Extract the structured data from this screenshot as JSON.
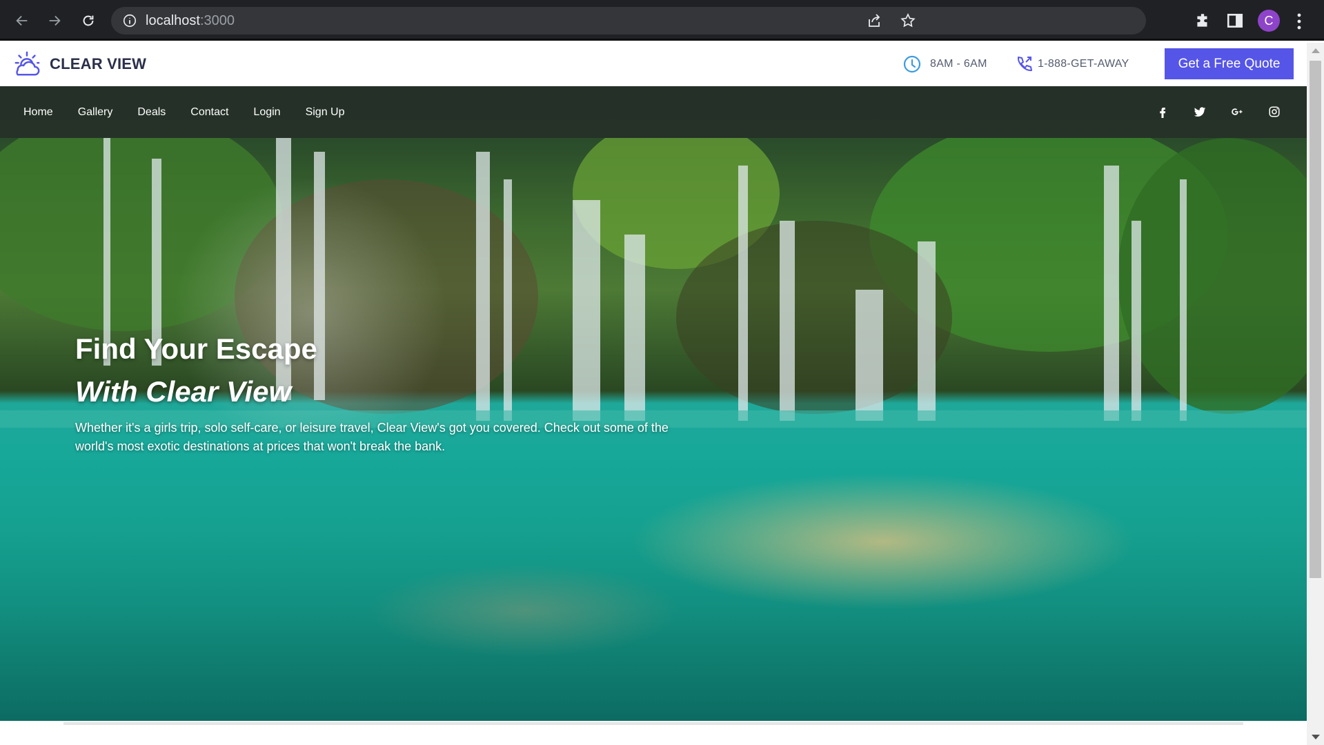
{
  "browser": {
    "url_host": "localhost",
    "url_port": ":3000",
    "profile_initial": "C",
    "profile_color": "#8e44c8"
  },
  "header": {
    "brand": "CLEAR VIEW",
    "hours": "8AM - 6AM",
    "phone": "1-888-GET-AWAY",
    "cta_label": "Get a Free Quote",
    "accent_color": "#5555e8"
  },
  "nav": {
    "links": [
      "Home",
      "Gallery",
      "Deals",
      "Contact",
      "Login",
      "Sign Up"
    ],
    "social": [
      "facebook-icon",
      "twitter-icon",
      "google-plus-icon",
      "instagram-icon"
    ]
  },
  "hero": {
    "title_line1": "Find Your Escape",
    "title_line2": "With Clear View",
    "description": "Whether it's a girls trip, solo self-care, or leisure travel, Clear View's got you covered. Check out some of the world's most exotic destinations at prices that won't break the bank."
  }
}
